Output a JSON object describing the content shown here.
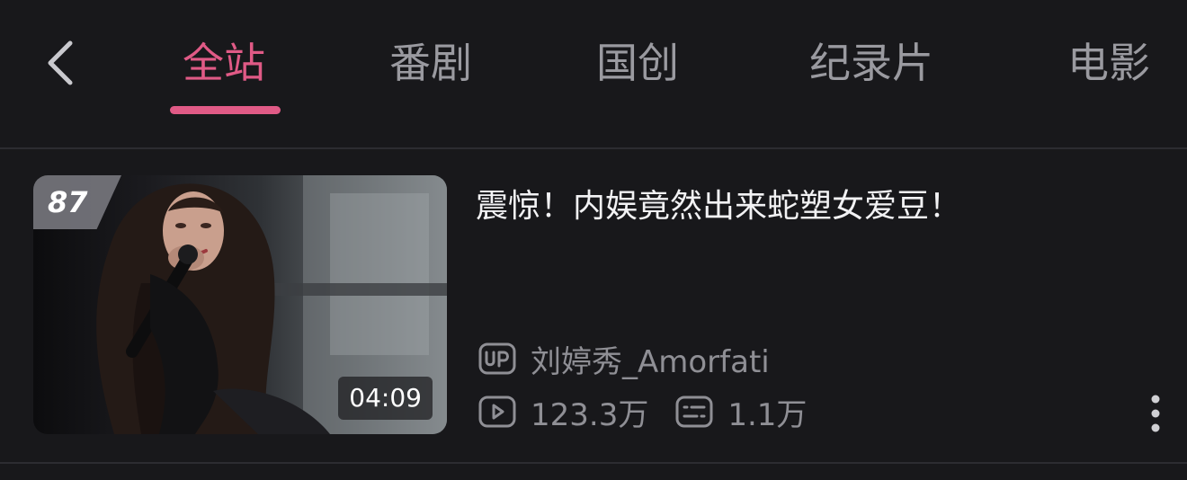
{
  "nav": {
    "back_icon": "chevron-left-icon",
    "tabs": [
      {
        "label": "全站",
        "active": true
      },
      {
        "label": "番剧",
        "active": false
      },
      {
        "label": "国创",
        "active": false
      },
      {
        "label": "纪录片",
        "active": false
      },
      {
        "label": "电影",
        "active": false
      }
    ]
  },
  "colors": {
    "accent": "#e05a86",
    "background": "#18181b",
    "text_muted": "#8f8f95"
  },
  "video": {
    "score": "87",
    "duration": "04:09",
    "title": "震惊！内娱竟然出来蛇塑女爱豆！",
    "uploader": "刘婷秀_Amorfati",
    "plays": "123.3万",
    "danmaku": "1.1万",
    "icons": [
      "up-badge-icon",
      "play-count-icon",
      "danmaku-icon",
      "more-vertical-icon"
    ]
  }
}
